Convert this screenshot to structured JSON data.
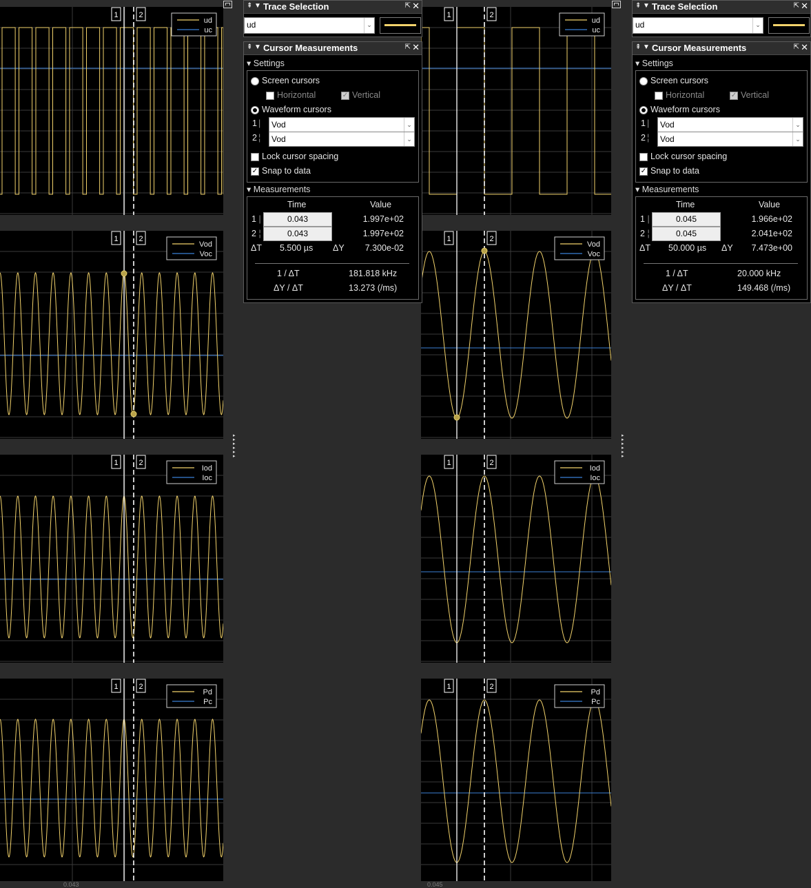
{
  "scope_left": {
    "x_tick_label": "0.043",
    "plots": [
      {
        "legend": [
          "ud",
          "uc"
        ]
      },
      {
        "legend": [
          "Vod",
          "Voc"
        ]
      },
      {
        "legend": [
          "Iod",
          "Ioc"
        ]
      },
      {
        "legend": [
          "Pd",
          "Pc"
        ]
      }
    ],
    "cursor_labels": [
      "1",
      "2"
    ]
  },
  "scope_right": {
    "x_tick_label": "0.045",
    "plots": [
      {
        "legend": [
          "ud",
          "uc"
        ]
      },
      {
        "legend": [
          "Vod",
          "Voc"
        ]
      },
      {
        "legend": [
          "Iod",
          "Ioc"
        ]
      },
      {
        "legend": [
          "Pd",
          "Pc"
        ]
      }
    ],
    "cursor_labels": [
      "1",
      "2"
    ]
  },
  "colors": {
    "trace_primary": "#f3d36b",
    "trace_secondary": "#3b7fd6",
    "cursor": "#ffffff",
    "background": "#000000"
  },
  "panels": [
    {
      "trace_selection": {
        "title": "Trace Selection",
        "selected": "ud"
      },
      "cursor": {
        "title": "Cursor Measurements",
        "settings_label": "Settings",
        "screen_cursors": "Screen cursors",
        "horizontal": "Horizontal",
        "vertical": "Vertical",
        "waveform_cursors": "Waveform cursors",
        "cursor1_label": "1",
        "cursor2_label": "2",
        "cursor1_signal": "Vod",
        "cursor2_signal": "Vod",
        "lock_spacing": "Lock cursor spacing",
        "snap": "Snap to data",
        "measurements_label": "Measurements",
        "col_time": "Time",
        "col_value": "Value",
        "t1": "0.043",
        "v1": "1.997e+02",
        "t2": "0.043",
        "v2": "1.997e+02",
        "dT_label": "ΔT",
        "dT": "5.500 µs",
        "dY_label": "ΔY",
        "dY": "7.300e-02",
        "inv_dT_label": "1 / ΔT",
        "inv_dT": "181.818 kHz",
        "slope_label": "ΔY / ΔT",
        "slope": "13.273 (/ms)"
      }
    },
    {
      "trace_selection": {
        "title": "Trace Selection",
        "selected": "ud"
      },
      "cursor": {
        "title": "Cursor Measurements",
        "settings_label": "Settings",
        "screen_cursors": "Screen cursors",
        "horizontal": "Horizontal",
        "vertical": "Vertical",
        "waveform_cursors": "Waveform cursors",
        "cursor1_label": "1",
        "cursor2_label": "2",
        "cursor1_signal": "Vod",
        "cursor2_signal": "Vod",
        "lock_spacing": "Lock cursor spacing",
        "snap": "Snap to data",
        "measurements_label": "Measurements",
        "col_time": "Time",
        "col_value": "Value",
        "t1": "0.045",
        "v1": "1.966e+02",
        "t2": "0.045",
        "v2": "2.041e+02",
        "dT_label": "ΔT",
        "dT": "50.000 µs",
        "dY_label": "ΔY",
        "dY": "7.473e+00",
        "inv_dT_label": "1 / ΔT",
        "inv_dT": "20.000 kHz",
        "slope_label": "ΔY / ΔT",
        "slope": "149.468 (/ms)"
      }
    }
  ]
}
